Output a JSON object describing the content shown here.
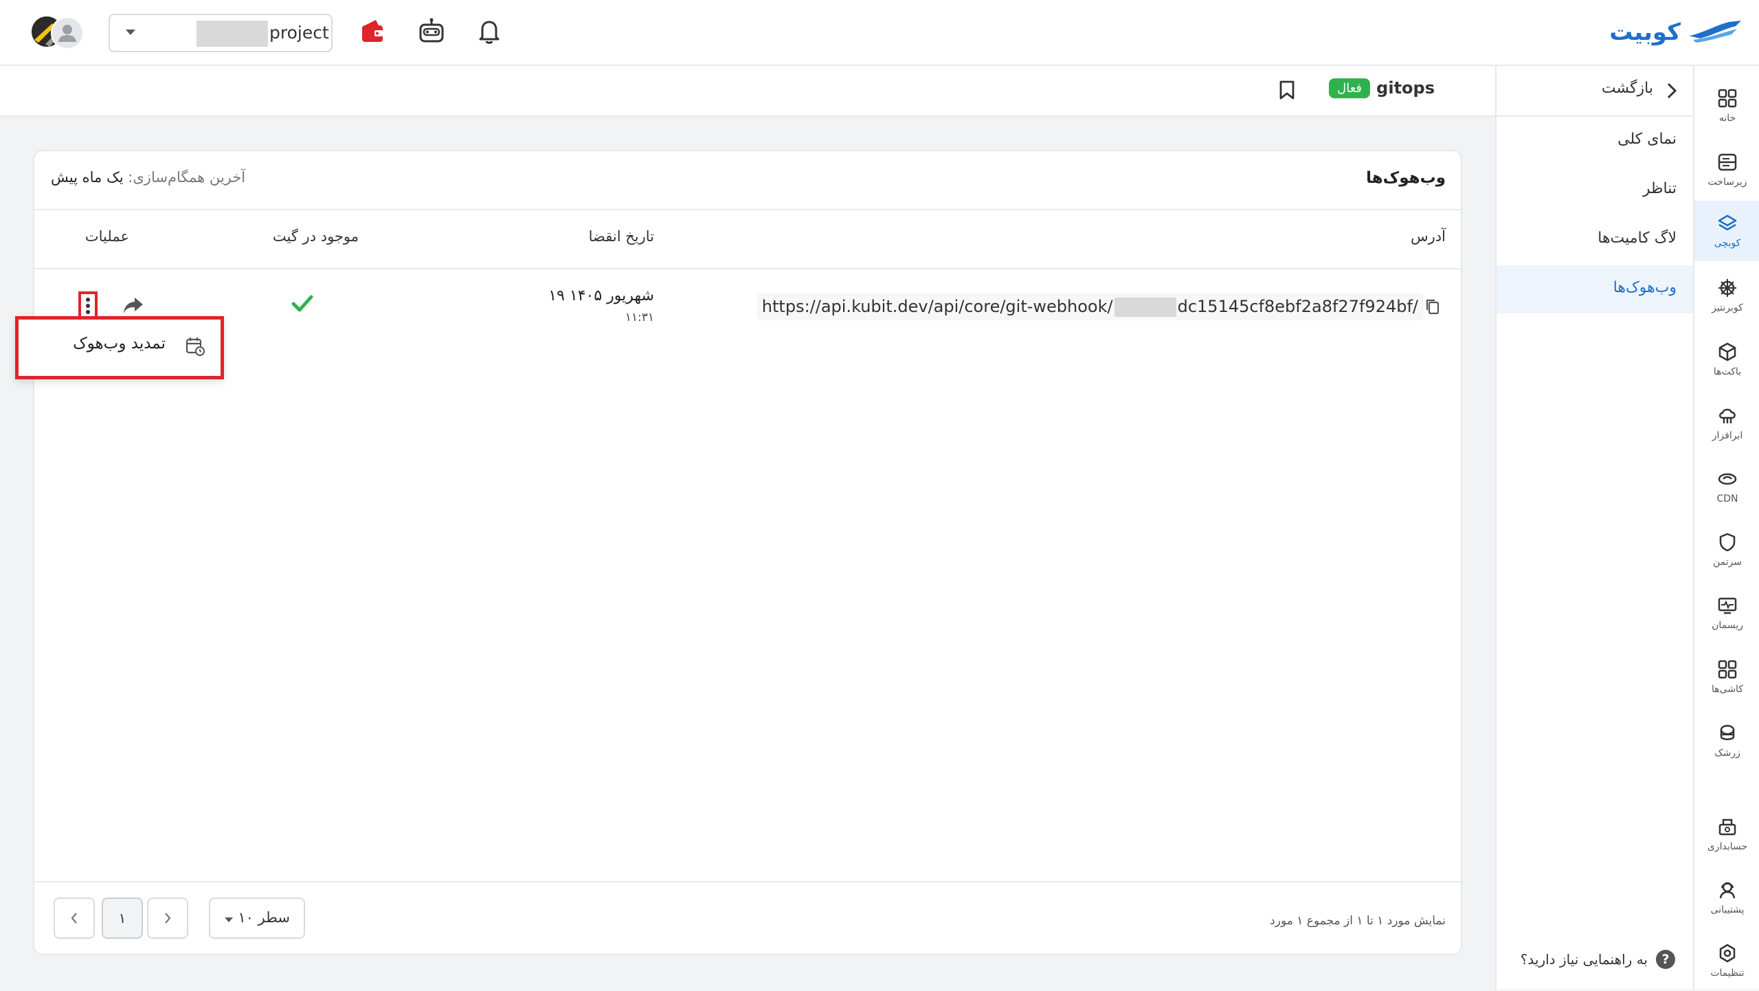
{
  "topbar": {
    "brand": "کوبیت",
    "project_label": "project"
  },
  "rail": {
    "items": [
      {
        "label": "خانه",
        "icon": "grid-icon"
      },
      {
        "label": "زیرساخت",
        "icon": "server-icon"
      },
      {
        "label": "کوبچی",
        "icon": "layers-icon",
        "active": true
      },
      {
        "label": "کوبرنتیز",
        "icon": "helm-wheel-icon"
      },
      {
        "label": "باکت‌ها",
        "icon": "box-icon"
      },
      {
        "label": "ابرافزار",
        "icon": "cloud-app-icon"
      },
      {
        "label": "CDN",
        "icon": "cdn-icon"
      },
      {
        "label": "سرتمن",
        "icon": "shield-icon"
      },
      {
        "label": "ریسمان",
        "icon": "monitor-pulse-icon"
      },
      {
        "label": "کاشی‌ها",
        "icon": "tiles-icon"
      },
      {
        "label": "زرشک",
        "icon": "stethoscope-icon"
      },
      {
        "label": "حسابداری",
        "icon": "accounting-icon"
      },
      {
        "label": "پشتیبانی",
        "icon": "support-icon"
      },
      {
        "label": "تنظیمات",
        "icon": "gear-icon"
      }
    ]
  },
  "subnav": {
    "back": "بازگشت",
    "items": [
      {
        "label": "نمای کلی"
      },
      {
        "label": "تناظر"
      },
      {
        "label": "لاگ کامیت‌ها"
      },
      {
        "label": "وب‌هوک‌ها",
        "active": true
      }
    ],
    "help": "به راهنمایی نیاز دارید؟"
  },
  "header": {
    "repo_name": "gitops",
    "status": "فعال"
  },
  "card": {
    "title": "وب‌هوک‌ها",
    "sync_label": "آخرین همگام‌سازی:",
    "sync_value": "یک ماه پیش",
    "columns": {
      "address": "آدرس",
      "expiry": "تاریخ انقضا",
      "in_git": "موجود در گیت",
      "actions": "عملیات"
    },
    "rows": [
      {
        "url_prefix": "https://api.kubit.dev/api/core/git-webhook/",
        "url_suffix": "dc15145cf8ebf2a8f27f924bf/",
        "expiry_date": "۱۹ شهریور ۱۴۰۵",
        "expiry_time": "۱۱:۳۱",
        "in_git": true
      }
    ],
    "footer": {
      "showing": "نمایش مورد ۱ تا ۱ از مجموع ۱ مورد",
      "rows_per_page": "۱۰ سطر",
      "current_page": "۱"
    }
  },
  "menu": {
    "items": [
      {
        "label": "تمدید وب‌هوک",
        "icon": "calendar-refresh-icon"
      }
    ]
  },
  "colors": {
    "accent": "#1e6fc8",
    "success": "#2fb24d",
    "highlight": "#e0242b",
    "wallet": "#e0242b"
  }
}
